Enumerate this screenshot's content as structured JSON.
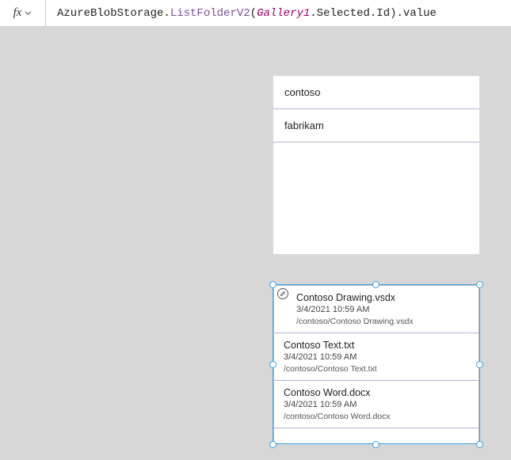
{
  "formulaBar": {
    "fxLabel": "fx",
    "prefix": "AzureBlobStorage.",
    "method": "ListFolderV2",
    "open": "(",
    "object": "Gallery1",
    "member": ".Selected.Id",
    "close": ").value"
  },
  "gallery1": {
    "items": [
      {
        "label": "contoso"
      },
      {
        "label": "fabrikam"
      }
    ]
  },
  "gallery2": {
    "items": [
      {
        "name": "Contoso Drawing.vsdx",
        "date": "3/4/2021 10:59 AM",
        "path": "/contoso/Contoso Drawing.vsdx"
      },
      {
        "name": "Contoso Text.txt",
        "date": "3/4/2021 10:59 AM",
        "path": "/contoso/Contoso Text.txt"
      },
      {
        "name": "Contoso Word.docx",
        "date": "3/4/2021 10:59 AM",
        "path": "/contoso/Contoso Word.docx"
      }
    ]
  }
}
